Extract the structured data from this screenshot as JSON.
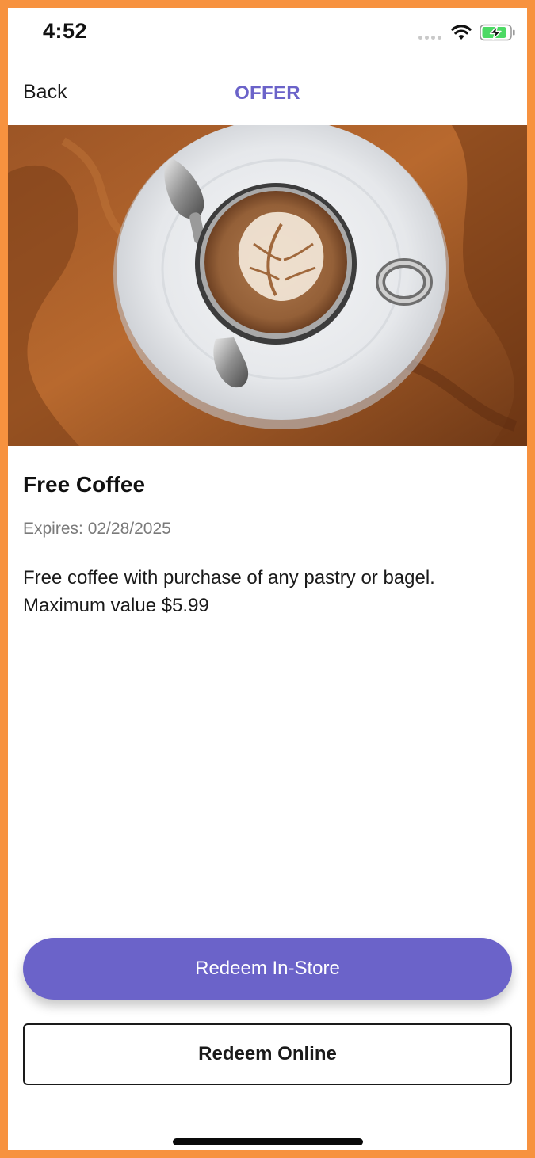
{
  "status_bar": {
    "time": "4:52",
    "icons": [
      "signal-dots-icon",
      "wifi-icon",
      "battery-charging-icon"
    ]
  },
  "header": {
    "back_label": "Back",
    "title": "OFFER"
  },
  "hero": {
    "icon": "coffee-latte-image"
  },
  "offer": {
    "title": "Free Coffee",
    "expires_label": "Expires: ",
    "expires_date": "02/28/2025",
    "description_lines": [
      "Free coffee with purchase of any pastry or bagel.",
      "Maximum value $5.99"
    ]
  },
  "actions": {
    "redeem_instore_label": "Redeem In-Store",
    "redeem_online_label": "Redeem Online"
  },
  "colors": {
    "accent": "#6B63C9",
    "frame": "#F7923F",
    "text": "#1A1A1A",
    "muted": "#7A7A7A"
  }
}
